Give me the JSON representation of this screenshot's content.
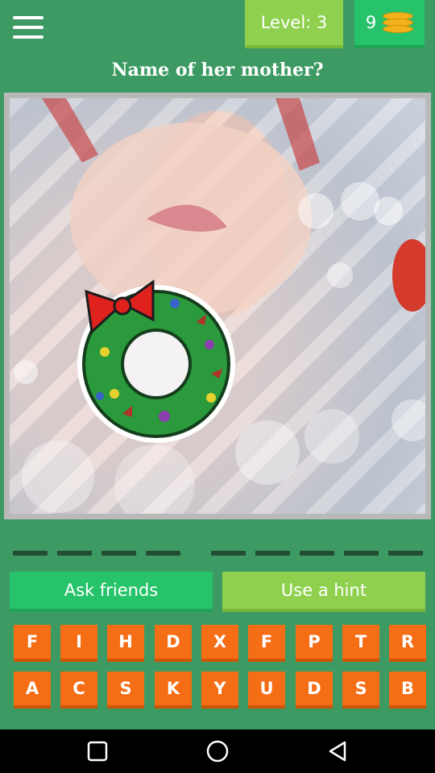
{
  "header": {
    "level_label": "Level: 3",
    "coins_count": "9"
  },
  "question": "Name of her mother?",
  "answer_slots": {
    "first_word_length": 4,
    "second_word_length": 5
  },
  "actions": {
    "ask_friends": "Ask friends",
    "use_hint": "Use a hint"
  },
  "letters": {
    "row1": [
      "F",
      "I",
      "H",
      "D",
      "X",
      "F",
      "P",
      "T",
      "R"
    ],
    "row2": [
      "A",
      "C",
      "S",
      "K",
      "Y",
      "U",
      "D",
      "S",
      "B"
    ]
  },
  "colors": {
    "background": "#3d9a63",
    "level_badge": "#8fd14f",
    "coin_badge": "#27c36a",
    "tile": "#f56d14",
    "slot": "#234c34"
  },
  "icons": {
    "menu": "hamburger-menu-icon",
    "coins": "coin-stack-icon",
    "nav_back": "triangle-back-icon",
    "nav_home": "circle-home-icon",
    "nav_recent": "square-recent-icon"
  }
}
